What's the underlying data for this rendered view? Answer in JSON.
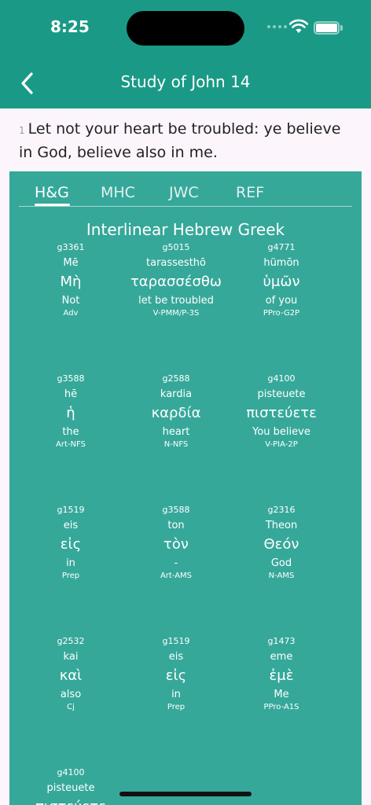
{
  "status": {
    "time": "8:25"
  },
  "nav": {
    "title": "Study of John 14"
  },
  "verse": {
    "number": "1",
    "text": "Let not your heart be troubled: ye believe in God, believe also in me."
  },
  "tabs": [
    {
      "label": "H&G"
    },
    {
      "label": "MHC"
    },
    {
      "label": "JWC"
    },
    {
      "label": "REF"
    }
  ],
  "interlinear": {
    "title": "Interlinear Hebrew Greek",
    "words": [
      {
        "strongs": "g3361",
        "translit": "Mē",
        "greek": "Μὴ",
        "english": "Not",
        "morph": "Adv"
      },
      {
        "strongs": "g5015",
        "translit": "tarassesthō",
        "greek": "ταρασσέσθω",
        "english": "let be troubled",
        "morph": "V-PMM/P-3S"
      },
      {
        "strongs": "g4771",
        "translit": "hümōn",
        "greek": "ὑμῶν",
        "english": "of you",
        "morph": "PPro-G2P"
      },
      {
        "strongs": "g3588",
        "translit": "hē",
        "greek": "ἡ",
        "english": "the",
        "morph": "Art-NFS"
      },
      {
        "strongs": "g2588",
        "translit": "kardia",
        "greek": "καρδία",
        "english": "heart",
        "morph": "N-NFS"
      },
      {
        "strongs": "g4100",
        "translit": "pisteuete",
        "greek": "πιστεύετε",
        "english": "You believe",
        "morph": "V-PIA-2P"
      },
      {
        "strongs": "g1519",
        "translit": "eis",
        "greek": "εἰς",
        "english": "in",
        "morph": "Prep"
      },
      {
        "strongs": "g3588",
        "translit": "ton",
        "greek": "τὸν",
        "english": "-",
        "morph": "Art-AMS"
      },
      {
        "strongs": "g2316",
        "translit": "Theon",
        "greek": "Θεόν",
        "english": "God",
        "morph": "N-AMS"
      },
      {
        "strongs": "g2532",
        "translit": "kai",
        "greek": "καὶ",
        "english": "also",
        "morph": "Cj"
      },
      {
        "strongs": "g1519",
        "translit": "eis",
        "greek": "εἰς",
        "english": "in",
        "morph": "Prep"
      },
      {
        "strongs": "g1473",
        "translit": "eme",
        "greek": "ἐμὲ",
        "english": "Me",
        "morph": "PPro-A1S"
      },
      {
        "strongs": "g4100",
        "translit": "pisteuete",
        "greek": "πιστεύετε",
        "english": "",
        "morph": ""
      }
    ]
  },
  "colors": {
    "header": "#1a9a86",
    "panel": "#36a89a",
    "background": "#fcf5fb"
  }
}
